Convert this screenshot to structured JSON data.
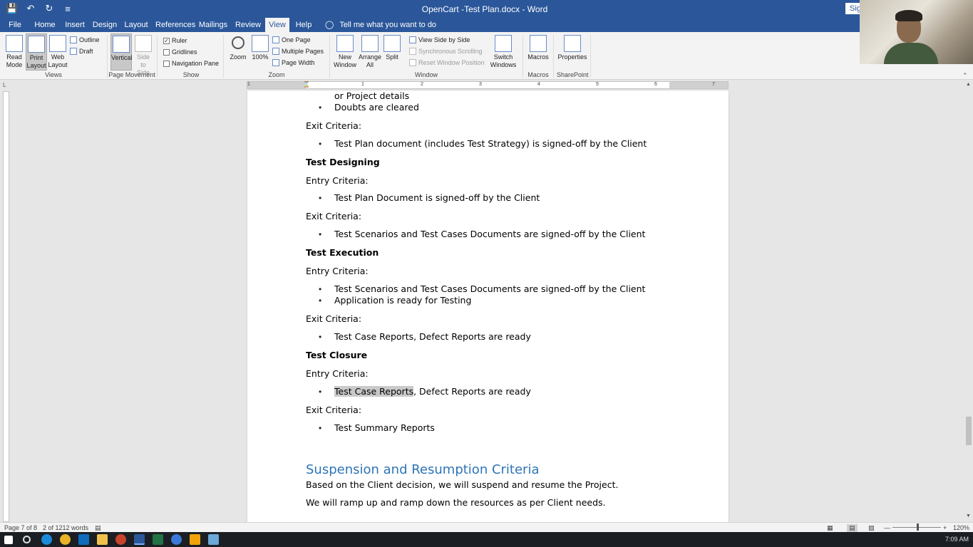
{
  "window": {
    "title": "OpenCart -Test Plan.docx - Word",
    "sign_in": "Sig"
  },
  "tabs": [
    {
      "label": "File",
      "active": false
    },
    {
      "label": "Home",
      "active": false
    },
    {
      "label": "Insert",
      "active": false
    },
    {
      "label": "Design",
      "active": false
    },
    {
      "label": "Layout",
      "active": false
    },
    {
      "label": "References",
      "active": false
    },
    {
      "label": "Mailings",
      "active": false
    },
    {
      "label": "Review",
      "active": false
    },
    {
      "label": "View",
      "active": true
    },
    {
      "label": "Help",
      "active": false
    }
  ],
  "tell_me": "Tell me what you want to do",
  "ribbon": {
    "views": {
      "label": "Views",
      "read_mode": "Read Mode",
      "print_layout": "Print Layout",
      "web_layout": "Web Layout",
      "outline": "Outline",
      "draft": "Draft"
    },
    "page_movement": {
      "label": "Page Movement",
      "vertical": "Vertical",
      "side_to_side": "Side to Side"
    },
    "show": {
      "label": "Show",
      "ruler": "Ruler",
      "ruler_checked": true,
      "gridlines": "Gridlines",
      "gridlines_checked": false,
      "navigation_pane": "Navigation Pane",
      "navigation_pane_checked": false
    },
    "zoom": {
      "label": "Zoom",
      "zoom": "Zoom",
      "hundred": "100%",
      "one_page": "One Page",
      "multiple_pages": "Multiple Pages",
      "page_width": "Page Width"
    },
    "window": {
      "label": "Window",
      "new_window": "New Window",
      "arrange_all": "Arrange All",
      "split": "Split",
      "view_side_by_side": "View Side by Side",
      "synchronous_scrolling": "Synchronous Scrolling",
      "reset_window_position": "Reset Window Position",
      "switch_windows": "Switch Windows"
    },
    "macros": {
      "label": "Macros",
      "macros": "Macros"
    },
    "sharepoint": {
      "label": "SharePoint",
      "properties": "Properties"
    }
  },
  "ruler_numbers": [
    "1",
    "1",
    "2",
    "3",
    "4",
    "5",
    "6",
    "7"
  ],
  "document": {
    "line1": "or Project details",
    "line2": "Doubts are cleared",
    "exit1": "Exit Criteria:",
    "exit1_b1": "Test Plan document (includes Test Strategy) is signed-off by the Client",
    "h_designing": "Test Designing",
    "entry2": "Entry Criteria:",
    "entry2_b1": "Test Plan Document is signed-off by the Client",
    "exit2": "Exit Criteria:",
    "exit2_b1": "Test Scenarios and Test Cases Documents are signed-off by the Client",
    "h_execution": "Test Execution",
    "entry3": "Entry Criteria:",
    "entry3_b1": "Test Scenarios and Test Cases Documents are signed-off by the Client",
    "entry3_b2": "Application is ready for Testing",
    "exit3": "Exit Criteria:",
    "exit3_b1": "Test Case Reports, Defect Reports are ready",
    "h_closure": "Test Closure",
    "entry4": "Entry Criteria:",
    "entry4_b1_sel": "Test Case Reports",
    "entry4_b1_rest": ", Defect Reports are ready",
    "exit4": "Exit Criteria:",
    "exit4_b1": "Test Summary Reports",
    "h_suspension": "Suspension and Resumption Criteria",
    "p1": "Based on the Client decision, we will suspend and resume the Project.",
    "p2": "We will ramp up and ramp down the resources as per Client needs."
  },
  "status": {
    "page": "Page 7 of 8",
    "words": "2 of 1212 words",
    "zoom": "120%"
  },
  "taskbar": {
    "time": "7:09 AM"
  },
  "colors": {
    "accent": "#2b579a",
    "heading": "#2e74b5",
    "selection": "#c9c9c9"
  }
}
